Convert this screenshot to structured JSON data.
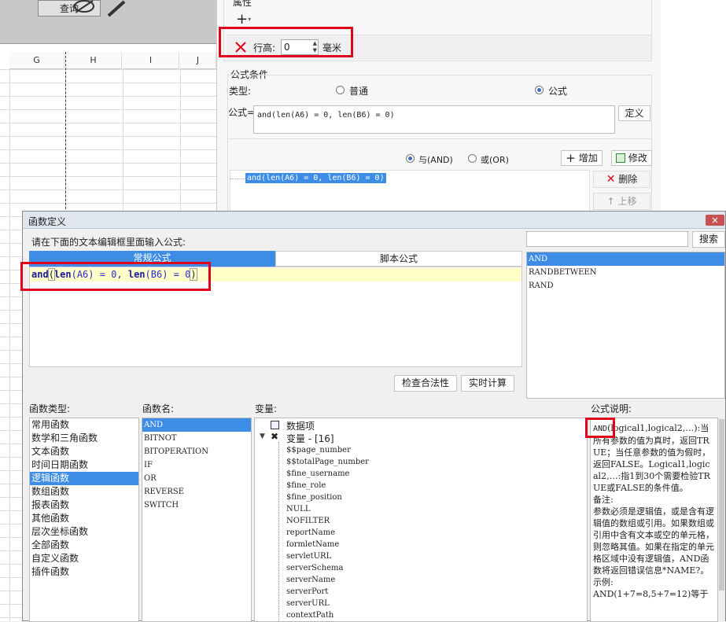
{
  "sheet": {
    "query_label": "查询",
    "columns": [
      "G",
      "H",
      "I",
      "J"
    ]
  },
  "props": {
    "attr_title": "属性",
    "add_glyph": "+",
    "row_height_label": "行高:",
    "row_height_value": "0",
    "row_height_unit": "毫米",
    "formula_cond_title": "公式条件",
    "type_label": "类型:",
    "type_normal": "普通",
    "type_formula": "公式",
    "formula_label": "公式=",
    "formula_value": "and(len(A6) = 0, len(B6) = 0)",
    "define_btn": "定义",
    "and_label": "与(AND)",
    "or_label": "或(OR)",
    "add_btn": "增加",
    "modify_btn": "修改",
    "list_item": "and(len(A6) = 0, len(B6) = 0)",
    "delete_btn": "删除",
    "up_btn": "上移"
  },
  "dialog": {
    "title": "函数定义",
    "close_glyph": "×",
    "prompt": "请在下面的文本编辑框里面输入公式:",
    "tab_normal": "常规公式",
    "tab_script": "脚本公式",
    "editor": {
      "kw": "and",
      "p1": "(",
      "fn1": "len",
      "a1": "(A6) = 0, ",
      "fn2": "len",
      "a2": "(B6) = 0",
      "p2": ")"
    },
    "check_btn": "检查合法性",
    "realtime_btn": "实时计算",
    "search_btn": "搜索",
    "search_results": [
      "AND",
      "RANDBETWEEN",
      "RAND"
    ],
    "func_type_label": "函数类型:",
    "func_types": [
      "常用函数",
      "数学和三角函数",
      "文本函数",
      "时间日期函数",
      "逻辑函数",
      "数组函数",
      "报表函数",
      "其他函数",
      "层次坐标函数",
      "全部函数",
      "自定义函数",
      "插件函数"
    ],
    "func_name_label": "函数名:",
    "func_names": [
      "AND",
      "BITNOT",
      "BITOPERATION",
      "IF",
      "OR",
      "REVERSE",
      "SWITCH"
    ],
    "var_label": "变量:",
    "var_root": "数据项",
    "var_group": "变量 - [16]",
    "vars": [
      "$$page_number",
      "$$totalPage_number",
      "$fine_username",
      "$fine_role",
      "$fine_position",
      "NULL",
      "NOFILTER",
      "reportName",
      "formletName",
      "servletURL",
      "serverSchema",
      "serverName",
      "serverPort",
      "serverURL",
      "contextPath"
    ],
    "desc_label": "公式说明:",
    "desc_keyword": "AND",
    "desc_text": "(logical1,logical2,…):当所有参数的值为真时，返回TRUE；当任意参数的值为假时，返回FALSE。Logical1,logical2,…:指1到30个需要检验TRUE或FALSE的条件值。\n备注:\n参数必须是逻辑值，或是含有逻辑值的数组或引用。如果数组或引用中含有文本或空的单元格，则忽略其值。如果在指定的单元格区域中没有逻辑值，AND函数将返回错误信息*NAME?。\n示例:\nAND(1+7=8,5+7=12)等于"
  },
  "colors": {
    "accent": "#3d8de6",
    "highlight": "#e0001b",
    "editor_line": "#ffffc8"
  }
}
